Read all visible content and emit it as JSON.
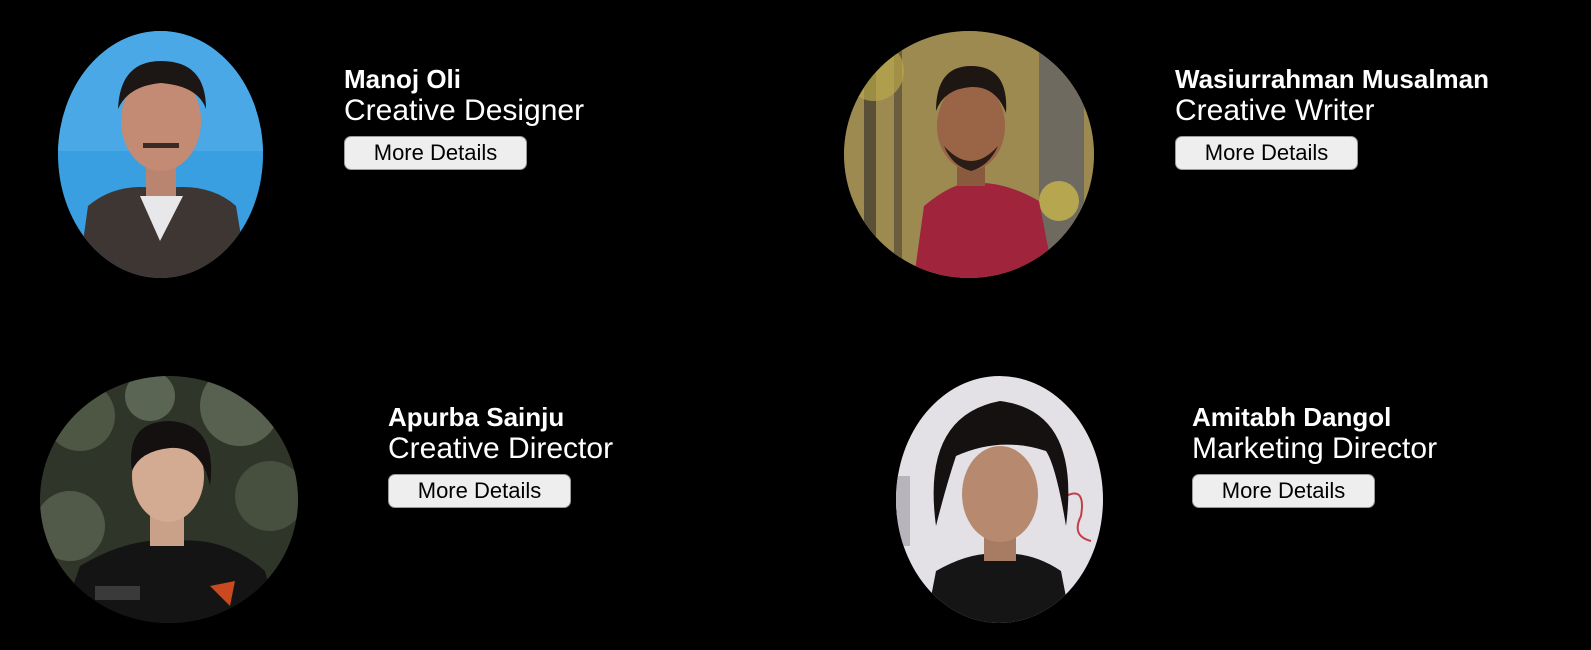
{
  "members": [
    {
      "name": "Manoj Oli",
      "role": "Creative Designer",
      "button_label": "More Details"
    },
    {
      "name": "Wasiurrahman Musalman",
      "role": "Creative Writer",
      "button_label": "More Details"
    },
    {
      "name": "Apurba Sainju",
      "role": "Creative Director",
      "button_label": "More Details"
    },
    {
      "name": "Amitabh Dangol",
      "role": "Marketing Director",
      "button_label": "More Details"
    }
  ],
  "colors": {
    "background": "#000000",
    "text": "#ffffff",
    "button_bg": "#eeeeee"
  }
}
